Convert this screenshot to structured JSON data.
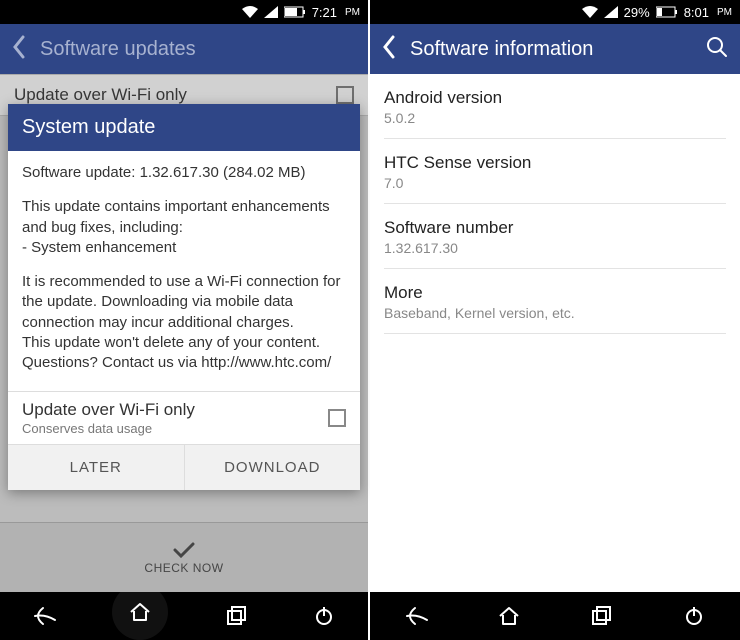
{
  "left": {
    "status": {
      "time": "7:21",
      "ampm": "PM"
    },
    "header": {
      "title": "Software updates"
    },
    "bg_row": {
      "label": "Update over Wi-Fi only"
    },
    "check_now": "CHECK NOW",
    "dialog": {
      "title": "System update",
      "line1": "Software update: 1.32.617.30 (284.02 MB)",
      "line2": "This update contains important enhancements and bug fixes, including:\n- System enhancement",
      "line3": "It is recommended to use a Wi-Fi connection for the update. Downloading via mobile data connection may incur additional charges.\nThis update won't delete any of your content.\nQuestions? Contact us via http://www.htc.com/",
      "wifi_title": "Update over Wi-Fi only",
      "wifi_sub": "Conserves data usage",
      "later": "LATER",
      "download": "DOWNLOAD"
    }
  },
  "right": {
    "status": {
      "pct": "29%",
      "time": "8:01",
      "ampm": "PM"
    },
    "header": {
      "title": "Software information"
    },
    "items": [
      {
        "label": "Android version",
        "value": "5.0.2"
      },
      {
        "label": "HTC Sense version",
        "value": "7.0"
      },
      {
        "label": "Software number",
        "value": "1.32.617.30"
      },
      {
        "label": "More",
        "value": "Baseband, Kernel version, etc."
      }
    ]
  }
}
